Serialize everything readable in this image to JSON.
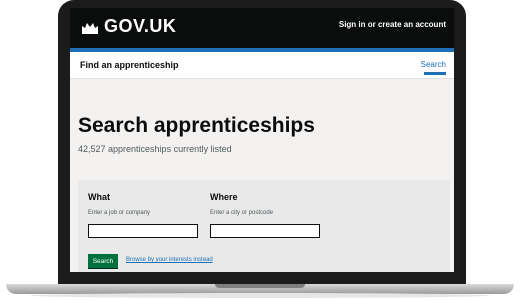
{
  "header": {
    "logo_text": "GOV.UK",
    "sign_in_text": "Sign in or create an account"
  },
  "service": {
    "name": "Find an apprenticeship",
    "nav_search": "Search"
  },
  "main": {
    "title": "Search apprenticeships",
    "listed_count": "42,527 apprenticeships currently listed"
  },
  "search_form": {
    "what_label": "What",
    "what_hint": "Enter a job or company",
    "what_value": "",
    "where_label": "Where",
    "where_hint": "Enter a city or postcode",
    "where_value": "",
    "search_button": "Search",
    "browse_link": "Browse by your interests instead"
  },
  "colors": {
    "header_bg": "#0b0c0c",
    "brand_blue": "#1d70b8",
    "button_green": "#00703c",
    "panel_grey": "#e9e9e9"
  }
}
